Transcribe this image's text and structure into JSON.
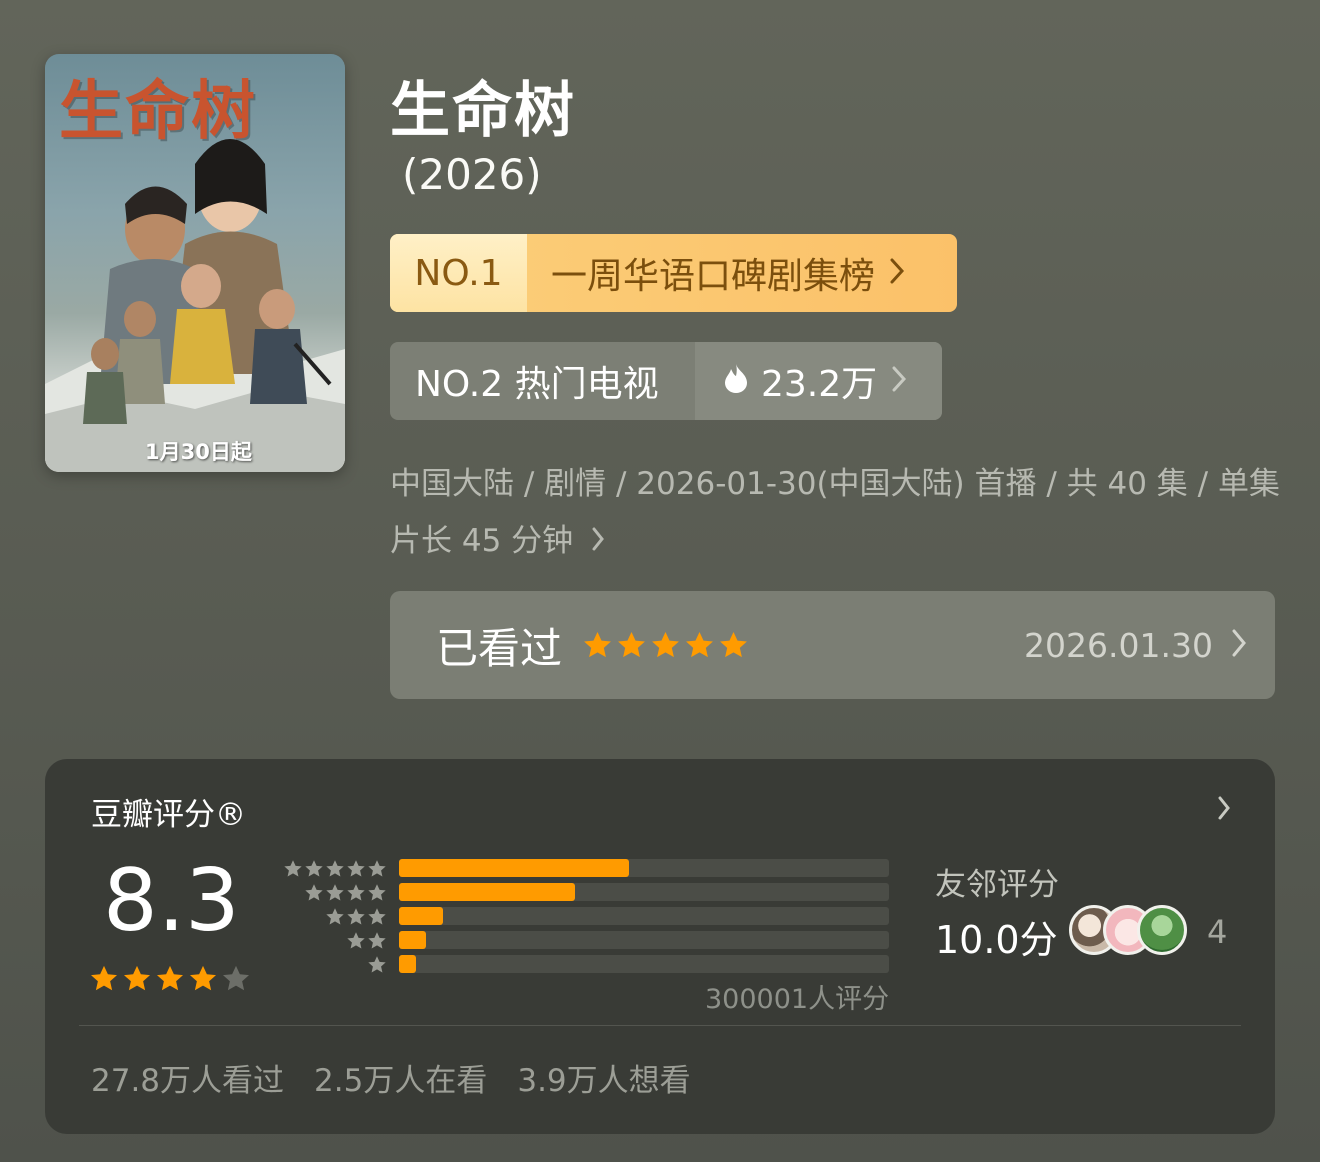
{
  "poster": {
    "title_art": "生命树",
    "date_text": "1月30日起"
  },
  "show": {
    "title": "生命树",
    "year": "(2026)"
  },
  "rank_primary": {
    "number": "NO.1",
    "label": "一周华语口碑剧集榜"
  },
  "rank_secondary": {
    "label": "NO.2 热门电视",
    "heat": "23.2万"
  },
  "meta_text": "中国大陆 / 剧情 / 2026-01-30(中国大陆) 首播 / 共 40 集 / 单集片长 45 分钟",
  "watched": {
    "label": "已看过",
    "stars": 5,
    "date": "2026.01.30"
  },
  "douban": {
    "title": "豆瓣评分®",
    "score": "8.3",
    "score_stars": 4,
    "ratings_count": "300001人评分",
    "distribution": [
      {
        "stars": 5,
        "fraction": 0.47
      },
      {
        "stars": 4,
        "fraction": 0.36
      },
      {
        "stars": 3,
        "fraction": 0.09
      },
      {
        "stars": 2,
        "fraction": 0.055
      },
      {
        "stars": 1,
        "fraction": 0.035
      }
    ],
    "friends_label": "友邻评分",
    "friends_score": "10.0分",
    "friends_count": "4",
    "stats": [
      "27.8万人看过",
      "2.5万人在看",
      "3.9万人想看"
    ]
  },
  "colors": {
    "accent_orange": "#ff9b00",
    "rank_gold": "#fbc169"
  }
}
